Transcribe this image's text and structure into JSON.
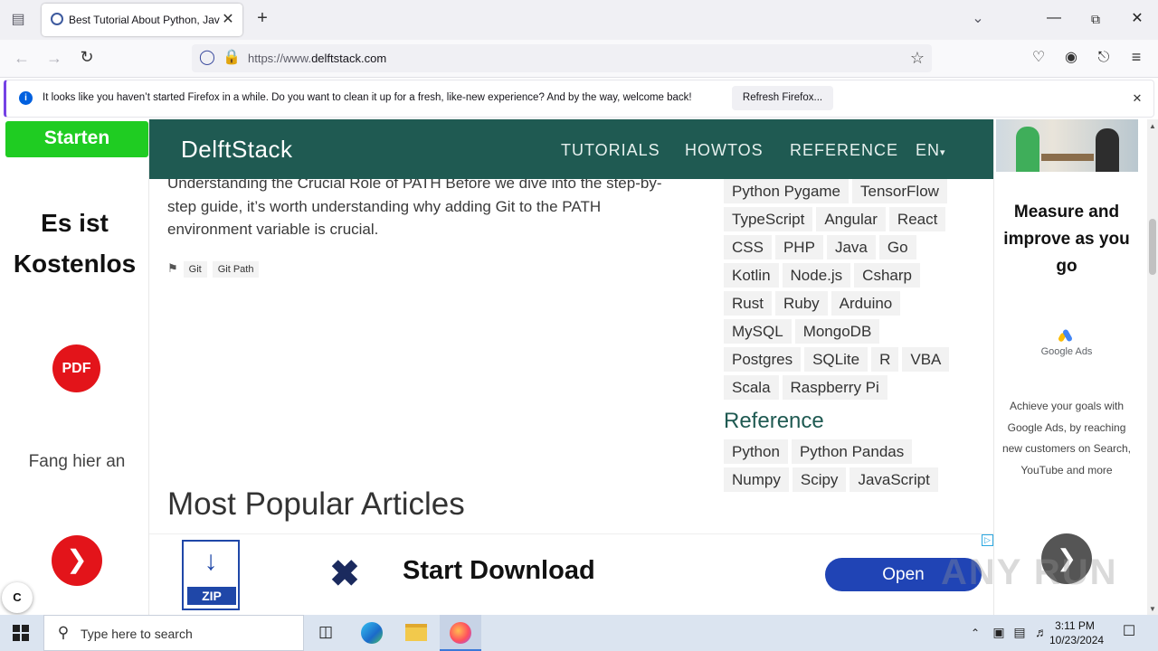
{
  "browser": {
    "tab_title": "Best Tutorial About Python, Jav",
    "url_prefix": "https://www.",
    "url_domain": "delftstack.com",
    "notification": "It looks like you haven’t started Firefox in a while. Do you want to clean it up for a fresh, like-new experience? And by the way, welcome back!",
    "refresh_label": "Refresh Firefox..."
  },
  "left_ad": {
    "top_button": "Starten",
    "headline": "Es ist Kostenlos",
    "pdf_label": "PDF",
    "cta_text": "Fang hier an",
    "corner_label": "C"
  },
  "site": {
    "logo": "DelftStack",
    "nav": [
      "TUTORIALS",
      "HOWTOS",
      "REFERENCE",
      "EN"
    ]
  },
  "article": {
    "text": "Understanding the Crucial Role of PATH Before we dive into the step-by-step guide, it’s worth understanding why adding Git to the PATH environment variable is crucial.",
    "tags": [
      "Git",
      "Git Path"
    ],
    "popular_heading": "Most Popular Articles"
  },
  "sidebar": {
    "topic_rows": [
      [
        "Python Pygame",
        "TensorFlow"
      ],
      [
        "TypeScript",
        "Angular",
        "React"
      ],
      [
        "CSS",
        "PHP",
        "Java",
        "Go"
      ],
      [
        "Kotlin",
        "Node.js",
        "Csharp"
      ],
      [
        "Rust",
        "Ruby",
        "Arduino"
      ],
      [
        "MySQL",
        "MongoDB"
      ],
      [
        "Postgres",
        "SQLite",
        "R",
        "VBA"
      ],
      [
        "Scala",
        "Raspberry Pi"
      ]
    ],
    "reference_heading": "Reference",
    "reference_rows": [
      [
        "Python",
        "Python Pandas"
      ],
      [
        "Numpy",
        "Scipy",
        "JavaScript"
      ]
    ]
  },
  "right_ad": {
    "headline": "Measure and improve as you go",
    "brand": "Google Ads",
    "body": "Achieve your goals with Google Ads, by reaching new customers on Search, YouTube and more"
  },
  "bottom_ad": {
    "zip_label": "ZIP",
    "headline": "Start Download",
    "button": "Open"
  },
  "watermark": "ANY RUN",
  "taskbar": {
    "search_placeholder": "Type here to search",
    "time": "3:11 PM",
    "date": "10/23/2024"
  },
  "colors": {
    "header_bg": "#1f5a52",
    "ad_green": "#1fcc22",
    "ad_red": "#e3141a",
    "open_blue": "#2044b5"
  }
}
